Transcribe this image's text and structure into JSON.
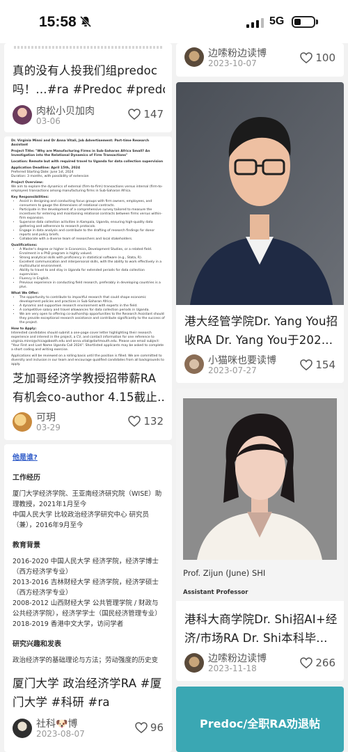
{
  "status": {
    "time": "15:58",
    "network": "5G"
  },
  "cards": {
    "l1": {
      "title1": "真的没有人投我们组predoc",
      "title2": "吗！...#ra #Predoc #predo...",
      "author": "肉松小贝加肉",
      "date": "03-06",
      "likes": "147"
    },
    "l2": {
      "title1": "芝加哥经济学教授招带薪RA",
      "title2": "有机会co-author 4.15截止...",
      "author": "可玥",
      "date": "03-29",
      "likes": "132",
      "doc": {
        "heading": "Dr. Virginia Minni and Dr Anna Vitali, Job Advertisement: Part-time Research Assistant",
        "project": "Project Title: \"Why are Manufacturing Firms in Sub-Saharan Africa Small? An Investigation into the Relational Dynamics of Firm Transactions\"",
        "location": "Location: Remote but with required travel to Uganda for data collection supervision",
        "deadline": "Application Deadline: April 15th, 2024",
        "start": "Preferred Starting Date: June 1st, 2024",
        "duration": "Duration: 3 months, with possibility of extension",
        "overview_h": "Project Overview:",
        "overview": "We aim to explore the dynamics of external (firm-to-firm) transactions versus internal (firm-to-employee) transactions among manufacturing firms in Sub-Saharan Africa.",
        "resp_h": "Key Responsibilities:",
        "resp": [
          "Assist in designing and conducting focus groups with firm owners, employees, and consumers to gauge the dimensions of relational contracts.",
          "Participate in the development of a comprehensive survey tailored to measure the incentives for entering and maintaining relational contracts between firms versus within-firm expansion.",
          "Supervise data collection activities in Kampala, Uganda, ensuring high-quality data gathering and adherence to research protocols.",
          "Engage in data analysis and contribute to the drafting of research findings for donor reports and policy briefs.",
          "Collaborate with a diverse team of researchers and local stakeholders."
        ],
        "qual_h": "Qualifications:",
        "qual": [
          "A Master's degree or higher in Economics, Development Studies, or a related field. Enrolment in a PhD program is highly valued.",
          "Strong analytical skills with proficiency in statistical software (e.g., Stata, R).",
          "Excellent communication and interpersonal skills, with the ability to work effectively in a multicultural environment.",
          "Ability to travel to and stay in Uganda for extended periods for data collection supervision.",
          "Fluency in English.",
          "Previous experience in conducting field research, preferably in developing countries is a plus."
        ],
        "offer_h": "What We Offer:",
        "offer": [
          "The opportunity to contribute to impactful research that could shape economic development policies and practices in Sub-Saharan Africa.",
          "A dynamic and supportive research environment with experts in the field.",
          "A competitive salary and travel allowances for data collection periods in Uganda.",
          "We are very open to offering co-authorship opportunities to the Research Assistant should they provide exceptional research assistance and contribute significantly to the success of the project."
        ],
        "apply_h": "How to Apply:",
        "apply": "Interested candidates should submit a one-page cover letter highlighting their research experience and interest in the project, a CV, and contact information for one reference to virginia.minni@chicagobooth.edu and anna.vitali@dartmouth.edu. Please use email subject: \"Your First and Last Name Uganda Call 2024\". Shortlisted applicants may be asked to complete a short coding and writing exercise.",
        "footer": "Applications will be reviewed on a rolling basis until the position is filled. We are committed to diversity and inclusion in our team and encourage qualified candidates from all backgrounds to apply."
      }
    },
    "l3": {
      "title1": "厦门大学 政治经济学RA #厦",
      "title2": "门大学 #科研 #ra",
      "author": "社科🐶博",
      "date": "2023-08-07",
      "likes": "96",
      "profile": {
        "who": "他是谁?",
        "sec1": "工作经历",
        "work1": "厦门大学经济学院、王亚南经济研究院（WISE）助理教授，2021年1月至今",
        "work2": "中国人民大学 比较政治经济学研究中心 研究员（兼），2016年9月至今",
        "sec2": "教育背景",
        "edu1": "2016-2020 中国人民大学 经济学院，经济学博士（西方经济学专业）",
        "edu2": "2013-2016 吉林财经大学 经济学院，经济学硕士（西方经济学专业）",
        "edu3": "2008-2012 山西财经大学 公共管理学院 / 财政与公共经济学院），经济学学士（国民经济管理专业）",
        "edu4": "2018-2019 香港中文大学，访问学者",
        "sec3": "研究兴趣和发表",
        "res1": "政治经济学的基础理论与方法；劳动强度的历史变"
      }
    },
    "r1": {
      "author": "边嗦粉边读博",
      "date": "2023-10-07",
      "likes": "100"
    },
    "r2": {
      "title1": "港大经管学院Dr. Yang You招",
      "title2": "收RA Dr. Yang You于202...",
      "author": "小猫咪也要读博",
      "date": "2023-07-27",
      "likes": "154"
    },
    "r3": {
      "caption_name": "Prof. Zijun (June) SHI",
      "caption_role": "Assistant Professor",
      "title1": "港科大商学院Dr. Shi招AI+经",
      "title2": "济/市场RA Dr. Shi本科毕...",
      "author": "边嗦粉边读博",
      "date": "2023-11-18",
      "likes": "266"
    },
    "r4": {
      "banner": "Predoc/全职RA劝退帖"
    }
  }
}
